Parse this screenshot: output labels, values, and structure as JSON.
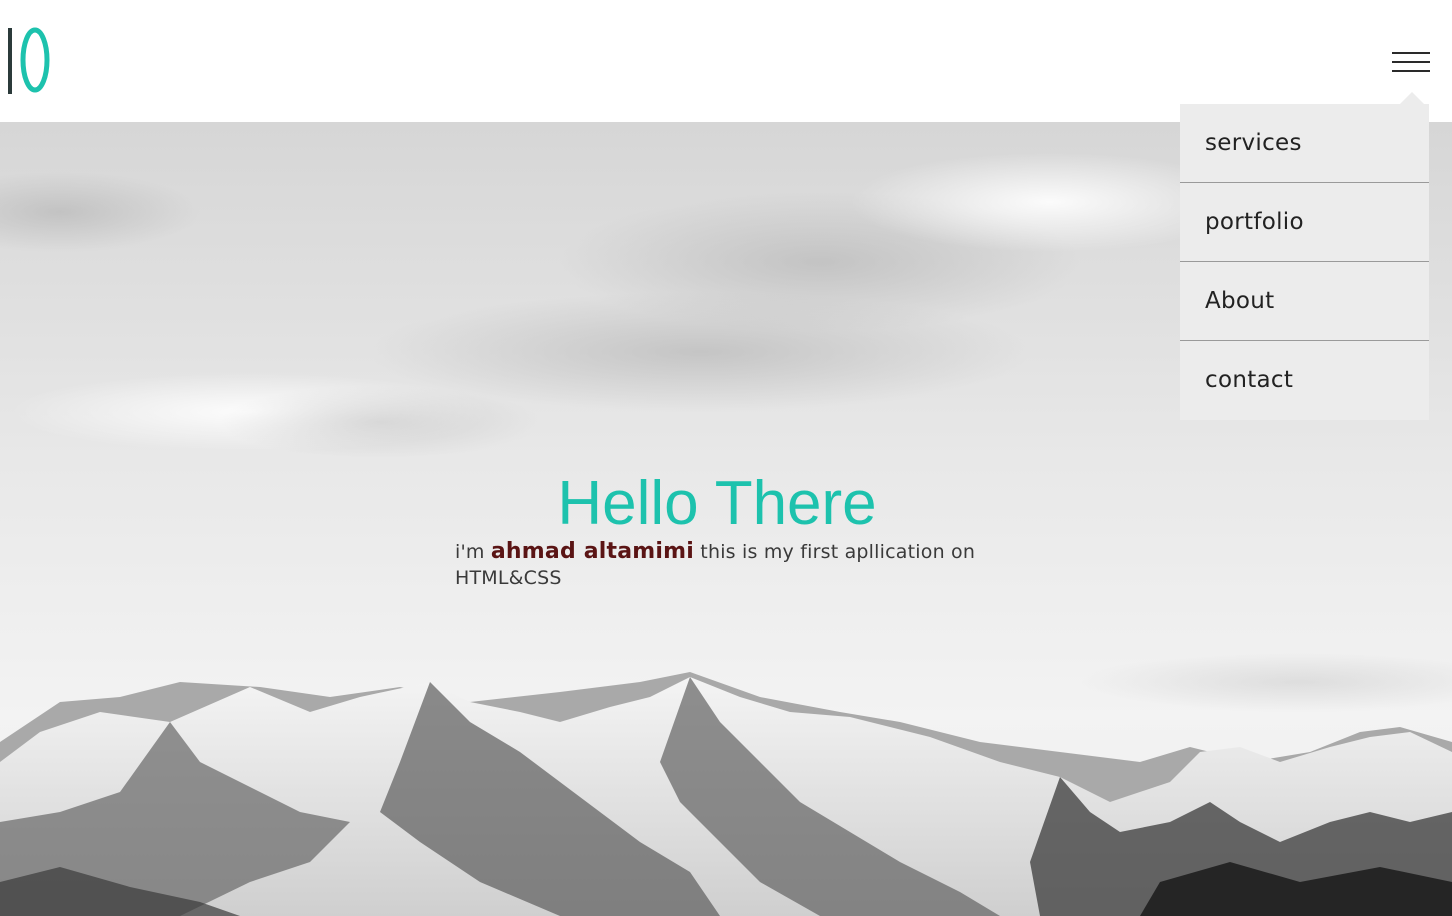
{
  "header": {
    "logo_icon": "io-logo-icon",
    "menu_icon": "hamburger-menu-icon",
    "colors": {
      "logo_dark": "#2b3a3a",
      "logo_accent": "#1dc2ad"
    }
  },
  "menu": {
    "items": [
      {
        "label": "services"
      },
      {
        "label": "portfolio"
      },
      {
        "label": "About"
      },
      {
        "label": "contact"
      }
    ],
    "background": "#ececec"
  },
  "hero": {
    "title": "Hello There",
    "subtitle_prefix": "i'm",
    "subtitle_name": "ahmad altamimi",
    "subtitle_suffix": "this is my first apllication on HTML&CSS",
    "colors": {
      "title": "#1dc2ad",
      "name": "#5a1414",
      "text": "#3a3a3a"
    }
  }
}
